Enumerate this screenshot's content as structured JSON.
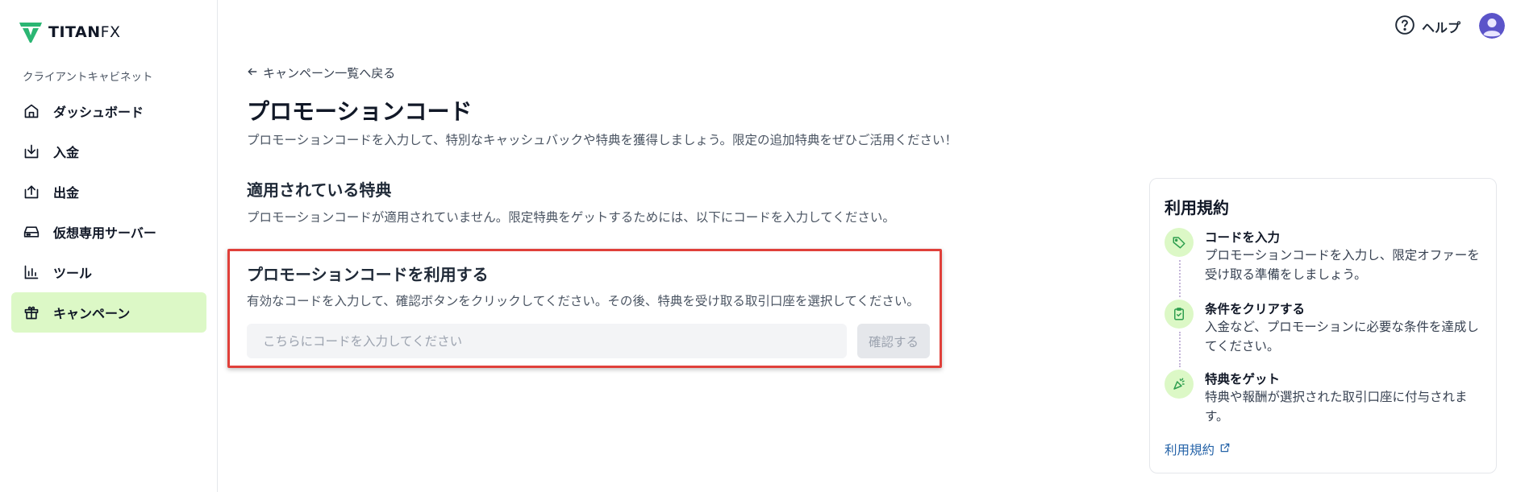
{
  "brand": {
    "name_main": "TITAN",
    "name_suffix": "FX",
    "logo_color": "#2bb673",
    "accent_bg": "#dcf8c6"
  },
  "sidebar": {
    "section_label": "クライアントキャビネット",
    "items": [
      {
        "label": "ダッシュボード",
        "icon": "home-icon",
        "active": false
      },
      {
        "label": "入金",
        "icon": "deposit-icon",
        "active": false
      },
      {
        "label": "出金",
        "icon": "withdraw-icon",
        "active": false
      },
      {
        "label": "仮想専用サーバー",
        "icon": "server-icon",
        "active": false
      },
      {
        "label": "ツール",
        "icon": "chart-icon",
        "active": false
      },
      {
        "label": "キャンペーン",
        "icon": "gift-icon",
        "active": true
      }
    ]
  },
  "header": {
    "help_label": "ヘルプ",
    "help_icon": "question-circle-icon",
    "avatar_icon": "user-avatar-icon"
  },
  "main": {
    "back_label": "キャンペーン一覧へ戻る",
    "title": "プロモーションコード",
    "description": "プロモーションコードを入力して、特別なキャッシュバックや特典を獲得しましょう。限定の追加特典をぜひご活用ください！",
    "applied": {
      "heading": "適用されている特典",
      "text": "プロモーションコードが適用されていません。限定特典をゲットするためには、以下にコードを入力してください。"
    },
    "redeem": {
      "heading": "プロモーションコードを利用する",
      "text": "有効なコードを入力して、確認ボタンをクリックしてください。その後、特典を受け取る取引口座を選択してください。",
      "input_value": "",
      "input_placeholder": "こちらにコードを入力してください",
      "confirm_label": "確認する"
    }
  },
  "terms": {
    "title": "利用規約",
    "steps": [
      {
        "title": "コードを入力",
        "desc": "プロモーションコードを入力し、限定オファーを受け取る準備をしましょう。",
        "icon": "tag-icon"
      },
      {
        "title": "条件をクリアする",
        "desc": "入金など、プロモーションに必要な条件を達成してください。",
        "icon": "clipboard-check-icon"
      },
      {
        "title": "特典をゲット",
        "desc": "特典や報酬が選択された取引口座に付与されます。",
        "icon": "party-popper-icon"
      }
    ],
    "link_label": "利用規約",
    "link_icon": "external-link-icon"
  }
}
